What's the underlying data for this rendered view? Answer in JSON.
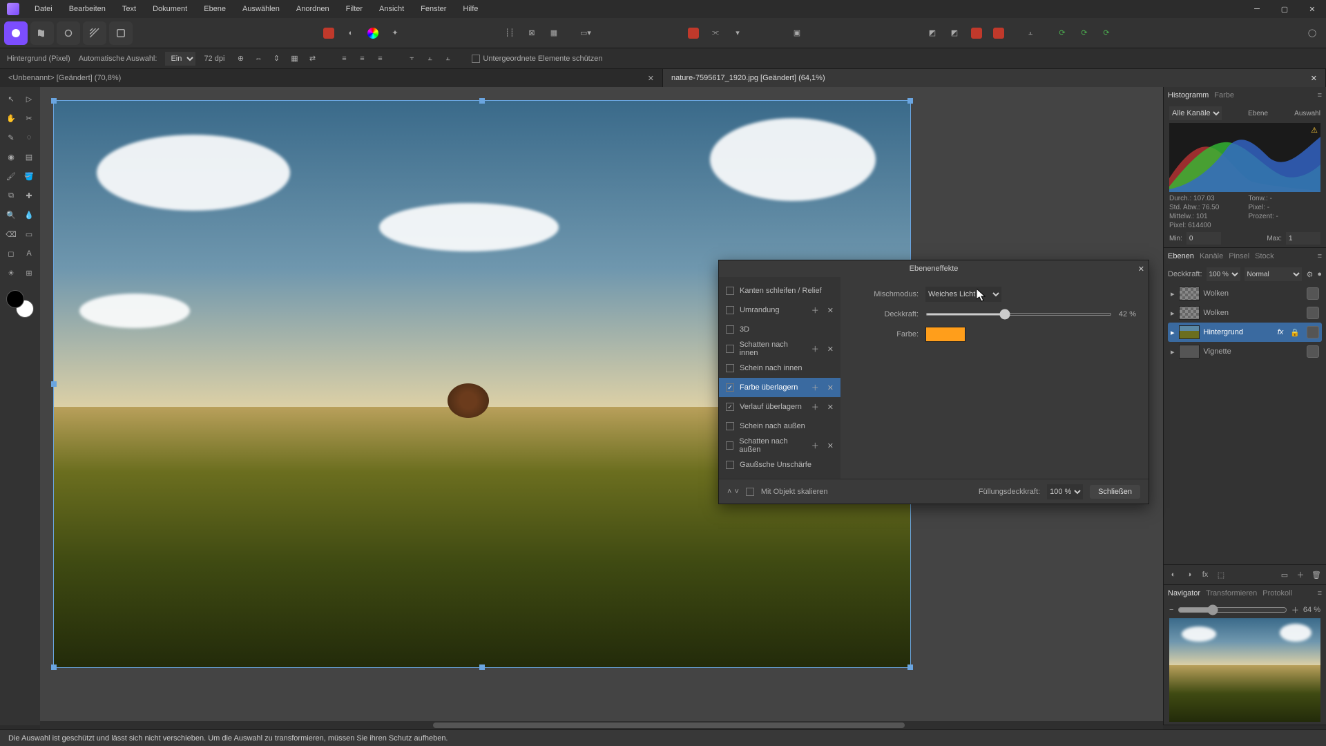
{
  "menu": {
    "items": [
      "Datei",
      "Bearbeiten",
      "Text",
      "Dokument",
      "Ebene",
      "Auswählen",
      "Anordnen",
      "Filter",
      "Ansicht",
      "Fenster",
      "Hilfe"
    ]
  },
  "context": {
    "layer_label": "Hintergrund (Pixel)",
    "mode_label": "Automatische Auswahl:",
    "mode_value": "Ein",
    "dpi": "72 dpi",
    "protect_label": "Untergeordnete Elemente schützen"
  },
  "tabs": [
    {
      "label": "<Unbenannt> [Geändert] (70,8%)",
      "active": false
    },
    {
      "label": "nature-7595617_1920.jpg [Geändert] (64,1%)",
      "active": true
    }
  ],
  "panels": {
    "histogram": {
      "tabs": [
        "Histogramm",
        "Farbe"
      ],
      "channel": "Alle Kanäle",
      "ebene": "Ebene",
      "auswahl": "Auswahl",
      "stats": {
        "durch": "Durch.: 107.03",
        "stdabw": "Std. Abw.: 76.50",
        "mittelw": "Mittelw.: 101",
        "pixel": "Pixel: 614400",
        "tonw": "Tonw.: -",
        "pixel2": "Pixel: -",
        "prozent": "Prozent: -"
      },
      "min_label": "Min:",
      "min": "0",
      "max_label": "Max:",
      "max": "1"
    },
    "layers": {
      "tabs": [
        "Ebenen",
        "Kanäle",
        "Pinsel",
        "Stock"
      ],
      "opacity_label": "Deckkraft:",
      "opacity": "100 %",
      "blend": "Normal",
      "items": [
        {
          "name": "Wolken",
          "thumb": "checker",
          "selected": false,
          "locked": false
        },
        {
          "name": "Wolken",
          "thumb": "checker",
          "selected": false,
          "locked": false
        },
        {
          "name": "Hintergrund",
          "thumb": "img",
          "selected": true,
          "locked": true,
          "fx": "fx"
        },
        {
          "name": "Vignette",
          "thumb": "solid",
          "selected": false,
          "locked": false
        }
      ]
    },
    "navigator": {
      "tabs": [
        "Navigator",
        "Transformieren",
        "Protokoll"
      ],
      "zoom": "64 %"
    }
  },
  "dialog": {
    "title": "Ebeneneffekte",
    "effects": [
      {
        "label": "Kanten schleifen / Relief",
        "checked": false,
        "add": false,
        "remove": false
      },
      {
        "label": "Umrandung",
        "checked": false,
        "add": true,
        "remove": true
      },
      {
        "label": "3D",
        "checked": false,
        "add": false,
        "remove": false
      },
      {
        "label": "Schatten nach innen",
        "checked": false,
        "add": true,
        "remove": true
      },
      {
        "label": "Schein nach innen",
        "checked": false,
        "add": false,
        "remove": false
      },
      {
        "label": "Farbe überlagern",
        "checked": true,
        "selected": true,
        "add": true,
        "remove": true
      },
      {
        "label": "Verlauf überlagern",
        "checked": true,
        "add": true,
        "remove": true
      },
      {
        "label": "Schein nach außen",
        "checked": false,
        "add": false,
        "remove": false
      },
      {
        "label": "Schatten nach außen",
        "checked": false,
        "add": true,
        "remove": true
      },
      {
        "label": "Gaußsche Unschärfe",
        "checked": false,
        "add": false,
        "remove": false
      }
    ],
    "props": {
      "mix_label": "Mischmodus:",
      "mix_value": "Weiches Licht",
      "opacity_label": "Deckkraft:",
      "opacity_value": "42 %",
      "color_label": "Farbe:",
      "color": "#ff9e1b"
    },
    "footer": {
      "scale_label": "Mit Objekt skalieren",
      "fill_label": "Füllungsdeckkraft:",
      "fill_value": "100 %",
      "close": "Schließen"
    }
  },
  "status": "Die Auswahl ist geschützt und lässt sich nicht verschieben. Um die Auswahl zu transformieren, müssen Sie ihren Schutz aufheben."
}
